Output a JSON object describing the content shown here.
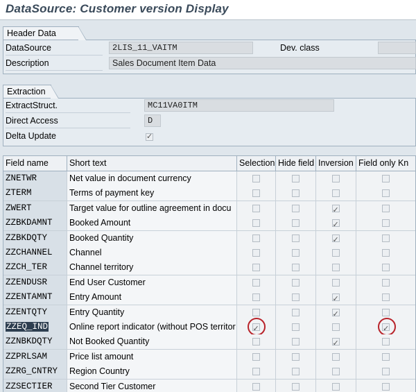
{
  "title": "DataSource: Customer version Display",
  "header": {
    "group_label": "Header Data",
    "datasource_label": "DataSource",
    "datasource_value": "2LIS_11_VAITM",
    "devclass_label": "Dev. class",
    "devclass_value": "",
    "description_label": "Description",
    "description_value": "Sales Document Item Data"
  },
  "extraction": {
    "group_label": "Extraction",
    "extractstruct_label": "ExtractStruct.",
    "extractstruct_value": "MC11VA0ITM",
    "direct_access_label": "Direct Access",
    "direct_access_value": "D",
    "delta_update_label": "Delta Update",
    "delta_update_checked": true
  },
  "table": {
    "columns": [
      "Field name",
      "Short text",
      "Selection",
      "Hide field",
      "Inversion",
      "Field only Kn"
    ],
    "rows": [
      {
        "field": "ZNETWR",
        "text": "Net value in document currency",
        "selection": false,
        "hide": false,
        "inversion": false,
        "known": false
      },
      {
        "field": "ZTERM",
        "text": "Terms of payment key",
        "selection": false,
        "hide": false,
        "inversion": false,
        "known": false
      },
      {
        "field": "ZWERT",
        "text": "Target value for outline agreement in docu",
        "selection": false,
        "hide": false,
        "inversion": true,
        "known": false
      },
      {
        "field": "ZZBKDAMNT",
        "text": "Booked Amount",
        "selection": false,
        "hide": false,
        "inversion": true,
        "known": false
      },
      {
        "field": "ZZBKDQTY",
        "text": "Booked Quantity",
        "selection": false,
        "hide": false,
        "inversion": true,
        "known": false
      },
      {
        "field": "ZZCHANNEL",
        "text": "Channel",
        "selection": false,
        "hide": false,
        "inversion": false,
        "known": false
      },
      {
        "field": "ZZCH_TER",
        "text": "Channel territory",
        "selection": false,
        "hide": false,
        "inversion": false,
        "known": false
      },
      {
        "field": "ZZENDUSR",
        "text": "End User Customer",
        "selection": false,
        "hide": false,
        "inversion": false,
        "known": false
      },
      {
        "field": "ZZENTAMNT",
        "text": "Entry Amount",
        "selection": false,
        "hide": false,
        "inversion": true,
        "known": false
      },
      {
        "field": "ZZENTQTY",
        "text": "Entry Quantity",
        "selection": false,
        "hide": false,
        "inversion": true,
        "known": false
      },
      {
        "field": "ZZEQ_IND",
        "text": "Online report indicator (without POS territor",
        "selection": true,
        "hide": false,
        "inversion": false,
        "known": true
      },
      {
        "field": "ZZNBKDQTY",
        "text": "Not Booked Quantity",
        "selection": false,
        "hide": false,
        "inversion": true,
        "known": false
      },
      {
        "field": "ZZPRLSAM",
        "text": "Price list amount",
        "selection": false,
        "hide": false,
        "inversion": false,
        "known": false
      },
      {
        "field": "ZZRG_CNTRY",
        "text": "Region Country",
        "selection": false,
        "hide": false,
        "inversion": false,
        "known": false
      },
      {
        "field": "ZZSECTIER",
        "text": "Second Tier Customer",
        "selection": false,
        "hide": false,
        "inversion": false,
        "known": false
      }
    ]
  },
  "colors": {
    "highlight_circle": "#b8232a",
    "selected_cell_bg": "#2d3e50"
  }
}
